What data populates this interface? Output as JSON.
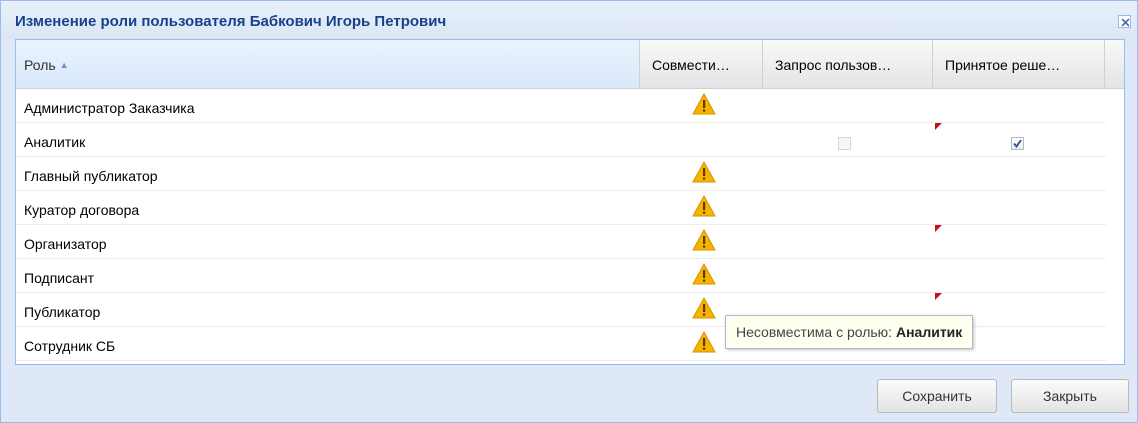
{
  "window": {
    "title": "Изменение роли пользователя Бабкович Игорь Петрович"
  },
  "grid": {
    "columns": {
      "role": "Роль",
      "compat": "Совмести…",
      "request": "Запрос пользов…",
      "decision": "Принятое реше…"
    },
    "rows": [
      {
        "role": "Администратор Заказчика"
      },
      {
        "role": "Аналитик"
      },
      {
        "role": "Главный публикатор"
      },
      {
        "role": "Куратор договора"
      },
      {
        "role": "Организатор"
      },
      {
        "role": "Подписант"
      },
      {
        "role": "Публикатор"
      },
      {
        "role": "Сотрудник СБ"
      }
    ]
  },
  "tooltip": {
    "prefix": "Несовместима с ролью:",
    "role": "Аналитик"
  },
  "buttons": {
    "save": "Сохранить",
    "close": "Закрыть"
  },
  "colors": {
    "title": "#15428b",
    "window_bg": "#dfe8f6",
    "border": "#99bbe8",
    "dirty_marker": "#c1121f",
    "warning": "#f5b400"
  }
}
